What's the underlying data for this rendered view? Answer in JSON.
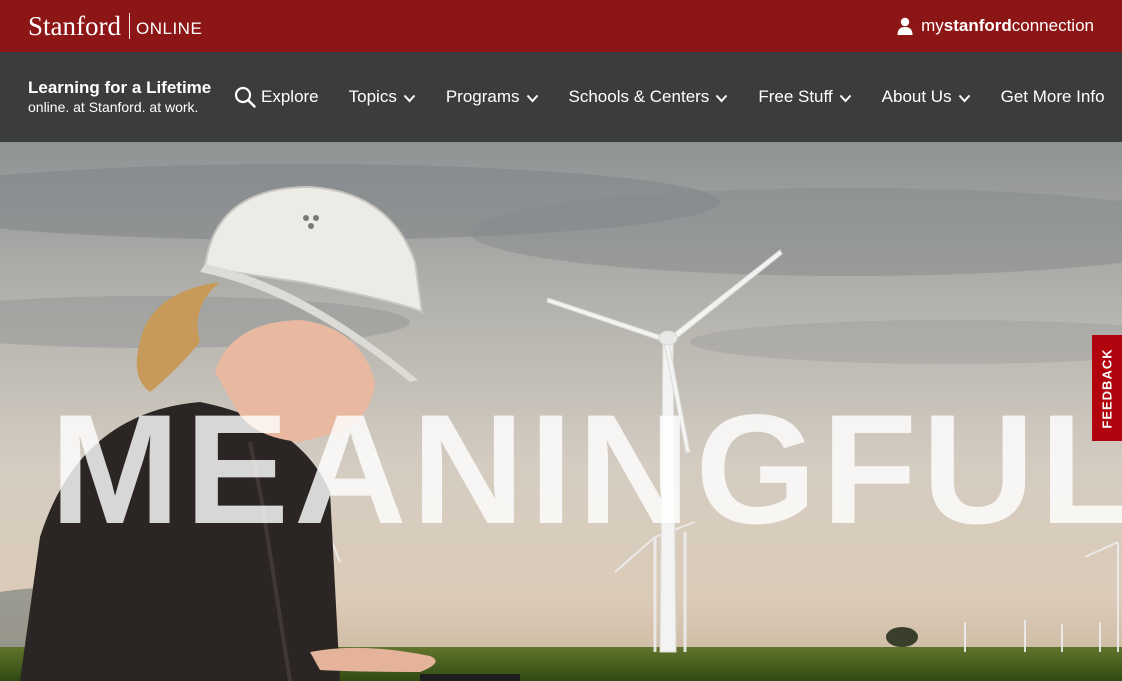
{
  "brand": {
    "name": "Stanford",
    "sub": "ONLINE",
    "colors": {
      "cardinal": "#8c1515",
      "nav_bg": "#3b3c3e",
      "feedback": "#b1040e"
    }
  },
  "account_link": {
    "prefix": "my",
    "bold": "stanford",
    "suffix": "connection",
    "icon": "user-icon"
  },
  "tagline": {
    "main": "Learning for a Lifetime",
    "sub": "online. at Stanford. at work."
  },
  "nav": {
    "explore": "Explore",
    "topics": "Topics",
    "programs": "Programs",
    "schools": "Schools & Centers",
    "free": "Free Stuff",
    "about": "About Us",
    "info": "Get More Info"
  },
  "hero": {
    "word": "MEANINGFUL"
  },
  "feedback": {
    "label": "FEEDBACK"
  }
}
